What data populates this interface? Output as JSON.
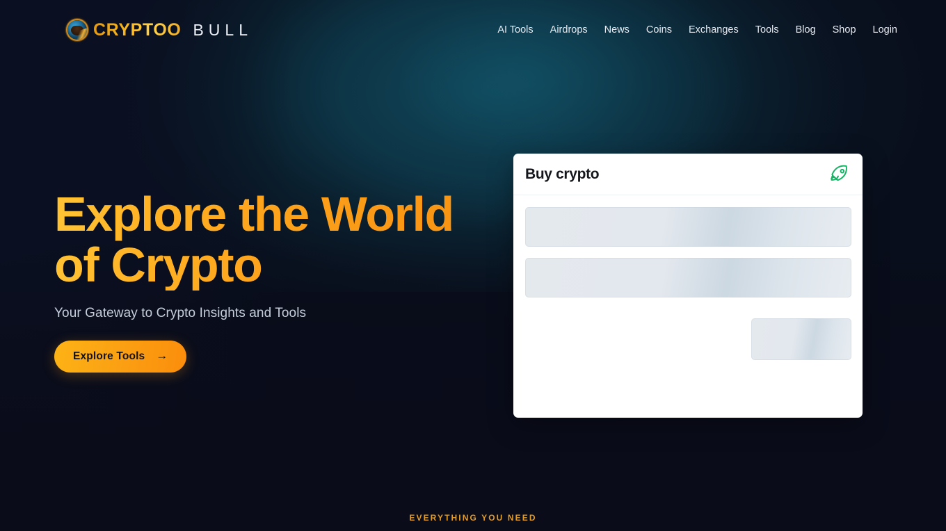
{
  "brand": {
    "mark_icon": "bull-globe-logo-icon",
    "word_primary": "CRYPTOO",
    "word_secondary": "BULL"
  },
  "nav": {
    "items": [
      {
        "label": "AI Tools"
      },
      {
        "label": "Airdrops"
      },
      {
        "label": "News"
      },
      {
        "label": "Coins"
      },
      {
        "label": "Exchanges"
      },
      {
        "label": "Tools"
      },
      {
        "label": "Blog"
      },
      {
        "label": "Shop"
      },
      {
        "label": "Login"
      }
    ]
  },
  "hero": {
    "title": "Explore the World of Crypto",
    "subtitle": "Your Gateway to Crypto Insights and Tools",
    "cta_label": "Explore Tools",
    "cta_arrow": "→"
  },
  "buy_widget": {
    "title": "Buy crypto",
    "icon": "rocket-icon",
    "rows": [
      {
        "state": "loading"
      },
      {
        "state": "loading"
      },
      {
        "state": "loading"
      }
    ]
  },
  "section_eyebrow": "EVERYTHING YOU NEED",
  "colors": {
    "accent_orange": "#fba213",
    "accent_gold": "#ffc436",
    "brand_gold": "#e49a12",
    "page_background": "#090e1c",
    "glow_teal": "#114c60",
    "card_background": "#ffffff",
    "rocket_green": "#16b364",
    "eyebrow": "#e59c23",
    "subtitle_text": "#c6cedb",
    "skeleton": "#e4e9ee"
  }
}
